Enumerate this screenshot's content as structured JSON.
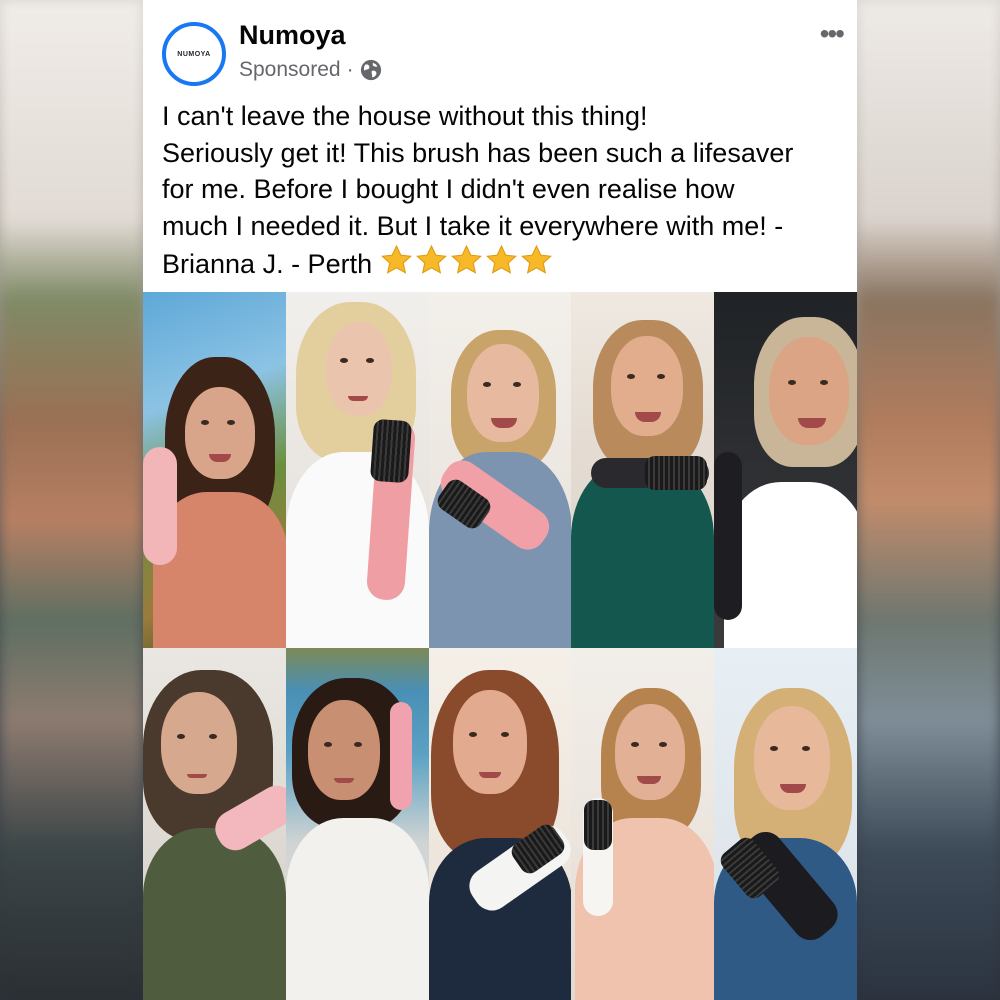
{
  "post": {
    "page_name": "Numoya",
    "avatar_text": "NUMOYA",
    "sponsored_label": "Sponsored",
    "separator": "·",
    "more_label": "•••",
    "caption_lines": [
      "I can't leave the house without this thing!",
      "Seriously get it! This brush has been such a lifesaver",
      "for me. Before I bought I didn't even realise how",
      "much I needed it. But I take it everywhere with me! -",
      "Brianna J. - Perth"
    ],
    "rating": 5
  },
  "colors": {
    "accent": "#1877f2",
    "star": "#f7b928",
    "text": "#050505",
    "muted": "#65676b"
  }
}
